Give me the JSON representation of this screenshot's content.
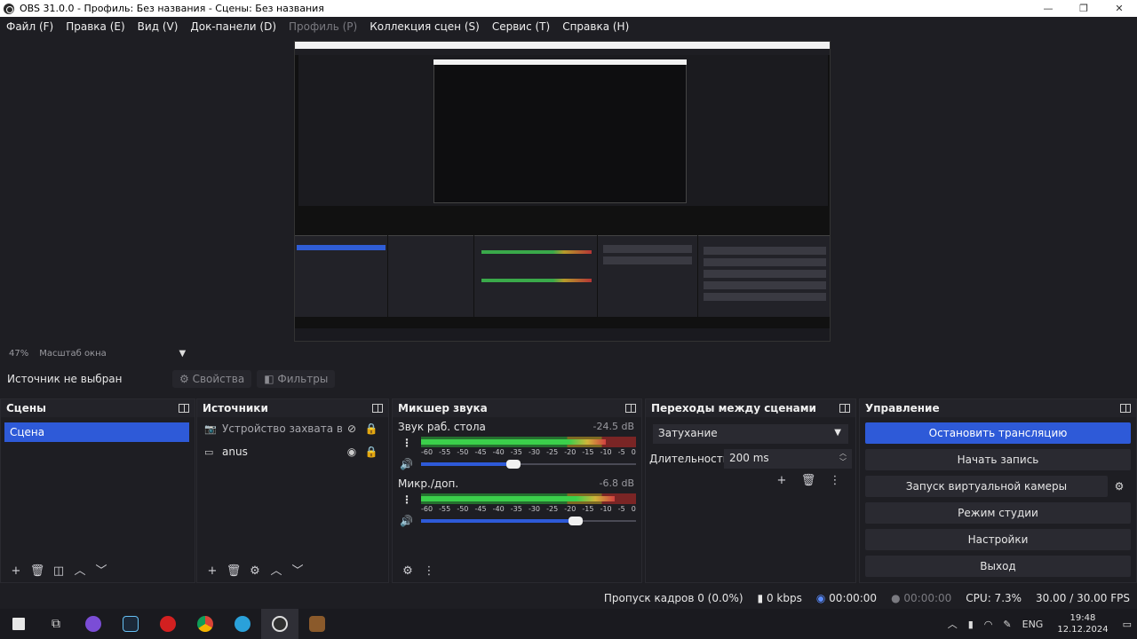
{
  "window": {
    "title": "OBS 31.0.0 - Профиль: Без названия - Сцены: Без названия",
    "minimize": "—",
    "maximize": "❐",
    "close": "✕"
  },
  "menu": {
    "file": "Файл (F)",
    "edit": "Правка (E)",
    "view": "Вид (V)",
    "docks": "Док-панели (D)",
    "profile": "Профиль (P)",
    "scene_collection": "Коллекция сцен (S)",
    "tools": "Сервис (T)",
    "help": "Справка (H)"
  },
  "preview": {
    "zoom": "47%",
    "zoom_mode": "Масштаб окна"
  },
  "source_bar": {
    "no_source": "Источник не выбран",
    "properties": "Свойства",
    "filters": "Фильтры"
  },
  "scenes": {
    "title": "Сцены",
    "items": [
      "Сцена"
    ]
  },
  "sources": {
    "title": "Источники",
    "items": [
      {
        "name": "Устройство захвата видео",
        "visible": false
      },
      {
        "name": "anus",
        "visible": true
      }
    ]
  },
  "mixer": {
    "title": "Микшер звука",
    "channels": [
      {
        "name": "Звук раб. стола",
        "db": "-24.5 dB",
        "level": 0.86,
        "volume": 0.43
      },
      {
        "name": "Микр./доп.",
        "db": "-6.8 dB",
        "level": 0.9,
        "volume": 0.72
      }
    ],
    "scale": [
      "-60",
      "-55",
      "-50",
      "-45",
      "-40",
      "-35",
      "-30",
      "-25",
      "-20",
      "-15",
      "-10",
      "-5",
      "0"
    ]
  },
  "transitions": {
    "title": "Переходы между сценами",
    "selected": "Затухание",
    "duration_label": "Длительность",
    "duration_value": "200 ms"
  },
  "controls": {
    "title": "Управление",
    "stop_stream": "Остановить трансляцию",
    "start_record": "Начать запись",
    "virtual_cam": "Запуск виртуальной камеры",
    "studio_mode": "Режим студии",
    "settings": "Настройки",
    "exit": "Выход"
  },
  "status": {
    "dropped_frames": "Пропуск кадров 0 (0.0%)",
    "bitrate": "0 kbps",
    "stream_time": "00:00:00",
    "record_time": "00:00:00",
    "cpu": "CPU: 7.3%",
    "fps": "30.00 / 30.00 FPS"
  },
  "taskbar": {
    "lang": "ENG",
    "time": "19:48",
    "date": "12.12.2024"
  },
  "colors": {
    "accent": "#2e5ad8",
    "background": "#1e1e23"
  }
}
